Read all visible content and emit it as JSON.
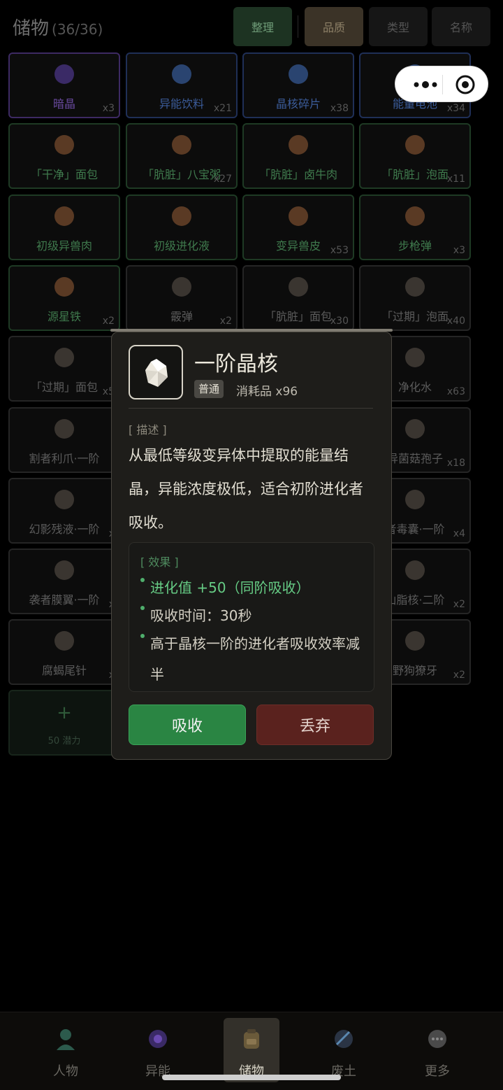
{
  "header": {
    "title": "储物",
    "count": "(36/36)",
    "sort_label": "整理",
    "filters": [
      "品质",
      "类型",
      "名称"
    ]
  },
  "grid": [
    {
      "name": "暗晶",
      "qty": "x3",
      "tier": "purple"
    },
    {
      "name": "异能饮料",
      "qty": "x21",
      "tier": "blue"
    },
    {
      "name": "晶核碎片",
      "qty": "x38",
      "tier": "blue"
    },
    {
      "name": "能量电池",
      "qty": "x34",
      "tier": "blue"
    },
    {
      "name": "「干净」面包",
      "qty": "",
      "tier": "green"
    },
    {
      "name": "「肮脏」八宝粥",
      "qty": "x27",
      "tier": "green"
    },
    {
      "name": "「肮脏」卤牛肉",
      "qty": "",
      "tier": "green"
    },
    {
      "name": "「肮脏」泡面",
      "qty": "x11",
      "tier": "green"
    },
    {
      "name": "初级异兽肉",
      "qty": "",
      "tier": "green"
    },
    {
      "name": "初级进化液",
      "qty": "",
      "tier": "green"
    },
    {
      "name": "变异兽皮",
      "qty": "x53",
      "tier": "green"
    },
    {
      "name": "步枪弹",
      "qty": "x3",
      "tier": "green"
    },
    {
      "name": "源星铁",
      "qty": "x2",
      "tier": "green"
    },
    {
      "name": "霰弹",
      "qty": "x2",
      "tier": "gray"
    },
    {
      "name": "「肮脏」面包",
      "qty": "x30",
      "tier": "gray"
    },
    {
      "name": "「过期」泡面",
      "qty": "x40",
      "tier": "gray"
    },
    {
      "name": "「过期」面包",
      "qty": "x5",
      "tier": "gray"
    },
    {
      "name": "",
      "qty": "",
      "tier": "gray"
    },
    {
      "name": "",
      "qty": "",
      "tier": "gray"
    },
    {
      "name": "净化水",
      "qty": "x63",
      "tier": "gray"
    },
    {
      "name": "割者利爪·一阶",
      "qty": "",
      "tier": "gray"
    },
    {
      "name": "",
      "qty": "",
      "tier": "gray"
    },
    {
      "name": "",
      "qty": "",
      "tier": "gray"
    },
    {
      "name": "异菌菇孢子",
      "qty": "x18",
      "tier": "gray"
    },
    {
      "name": "幻影残液·一阶",
      "qty": "x",
      "tier": "gray"
    },
    {
      "name": "",
      "qty": "",
      "tier": "gray"
    },
    {
      "name": "",
      "qty": "",
      "tier": "gray"
    },
    {
      "name": "者毒囊·一阶",
      "qty": "x4",
      "tier": "gray"
    },
    {
      "name": "袭者膜翼·一阶",
      "qty": "x",
      "tier": "gray"
    },
    {
      "name": "",
      "qty": "",
      "tier": "gray"
    },
    {
      "name": "",
      "qty": "",
      "tier": "gray"
    },
    {
      "name": "山脂核·二阶",
      "qty": "x2",
      "tier": "gray"
    },
    {
      "name": "腐蝎尾针",
      "qty": "x",
      "tier": "gray"
    },
    {
      "name": "",
      "qty": "",
      "tier": "gray"
    },
    {
      "name": "",
      "qty": "",
      "tier": "gray"
    },
    {
      "name": "野狗獠牙",
      "qty": "x2",
      "tier": "gray"
    }
  ],
  "add_slot": {
    "plus": "+",
    "label": "50 潜力"
  },
  "modal": {
    "title": "一阶晶核",
    "rarity": "普通",
    "category": "消耗品",
    "qty": "x96",
    "desc_label": "[ 描述 ]",
    "desc": "从最低等级变异体中提取的能量结晶，异能浓度极低，适合初阶进化者吸收。",
    "effect_label": "[ 效果 ]",
    "effects": [
      "进化值 +50（同阶吸收）",
      "吸收时间：30秒",
      "高于晶核一阶的进化者吸收效率减半"
    ],
    "absorb_label": "吸收",
    "drop_label": "丢弃"
  },
  "nav": [
    {
      "label": "人物"
    },
    {
      "label": "异能"
    },
    {
      "label": "储物"
    },
    {
      "label": "废土"
    },
    {
      "label": "更多"
    }
  ],
  "colors": {
    "accent_green": "#2a8543",
    "danger_red": "#5a221e",
    "effect_green": "#66cc85"
  }
}
